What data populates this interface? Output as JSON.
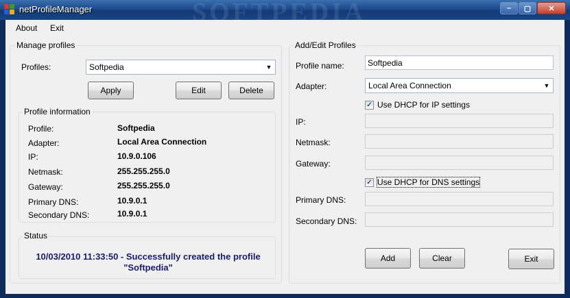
{
  "window": {
    "title": "netProfileManager",
    "watermark": "SOFTPEDIA"
  },
  "menu": {
    "about": "About",
    "exit": "Exit"
  },
  "manage": {
    "title": "Manage profiles",
    "profiles_label": "Profiles:",
    "profiles_value": "Softpedia",
    "apply": "Apply",
    "edit": "Edit",
    "delete": "Delete"
  },
  "info": {
    "title": "Profile information",
    "rows": [
      {
        "label": "Profile:",
        "value": "Softpedia"
      },
      {
        "label": "Adapter:",
        "value": "Local Area Connection"
      },
      {
        "label": "IP:",
        "value": "10.9.0.106"
      },
      {
        "label": "Netmask:",
        "value": "255.255.255.0"
      },
      {
        "label": "Gateway:",
        "value": "255.255.255.0"
      },
      {
        "label": "Primary DNS:",
        "value": "10.9.0.1"
      },
      {
        "label": "Secondary DNS:",
        "value": "10.9.0.1"
      }
    ]
  },
  "status": {
    "title": "Status",
    "line1": "10/03/2010 11:33:50 - Successfully created the profile",
    "line2": "\"Softpedia\""
  },
  "edit": {
    "title": "Add/Edit Profiles",
    "profile_name_label": "Profile name:",
    "profile_name_value": "Softpedia",
    "adapter_label": "Adapter:",
    "adapter_value": "Local Area Connection",
    "dhcp_ip_label": "Use DHCP for IP settings",
    "dhcp_ip_checked": true,
    "ip_label": "IP:",
    "netmask_label": "Netmask:",
    "gateway_label": "Gateway:",
    "dhcp_dns_label": "Use DHCP for DNS settings",
    "dhcp_dns_checked": true,
    "primary_dns_label": "Primary DNS:",
    "secondary_dns_label": "Secondary DNS:",
    "add": "Add",
    "clear": "Clear",
    "exit": "Exit"
  }
}
